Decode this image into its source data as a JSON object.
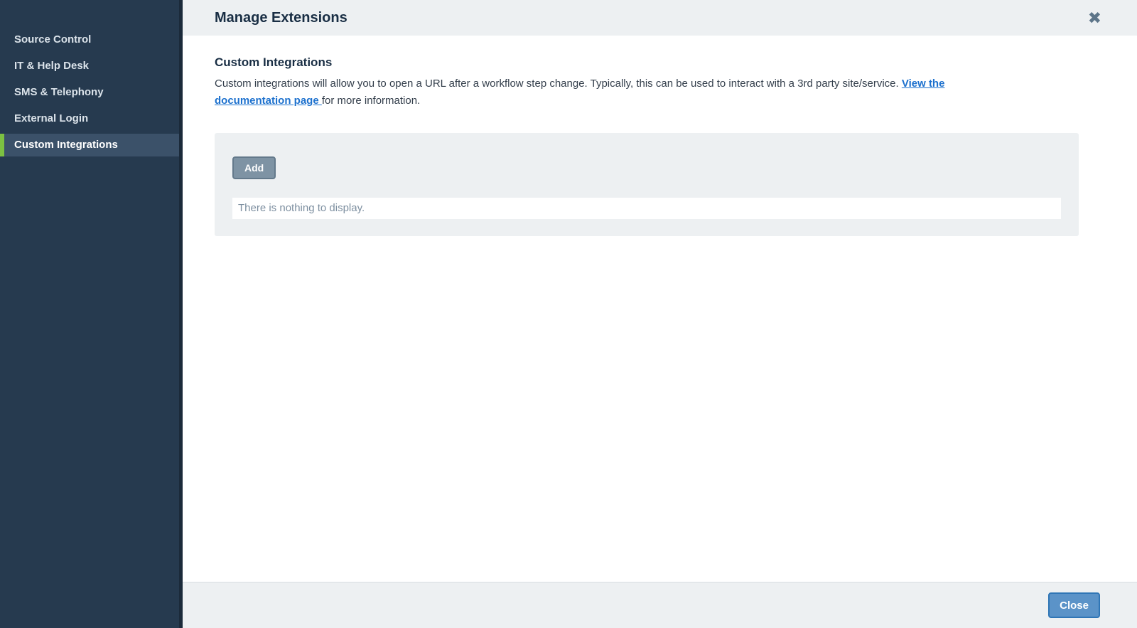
{
  "sidebar": {
    "items": [
      {
        "label": "Source Control",
        "selected": false
      },
      {
        "label": "IT & Help Desk",
        "selected": false
      },
      {
        "label": "SMS & Telephony",
        "selected": false
      },
      {
        "label": "External Login",
        "selected": false
      },
      {
        "label": "Custom Integrations",
        "selected": true
      }
    ]
  },
  "header": {
    "title": "Manage Extensions",
    "close_icon": "✖"
  },
  "main": {
    "section_title": "Custom Integrations",
    "description_before_link": "Custom integrations will allow you to open a URL after a workflow step change. Typically, this can be used to interact with a 3rd party site/service. ",
    "link_text": "View the documentation page ",
    "description_after_link": "for more information.",
    "add_button_label": "Add",
    "empty_message": "There is nothing to display."
  },
  "footer": {
    "close_button_label": "Close"
  },
  "colors": {
    "sidebar_bg": "#263a4f",
    "sidebar_border": "#1b2a3a",
    "sidebar_selected_bg": "#3b5169",
    "sidebar_text": "#dbe3ea",
    "accent_green": "#7cc142",
    "chrome_bg": "#edf0f2",
    "heading_color": "#192e44",
    "body_text": "#333e4b",
    "link_color": "#1d71ce",
    "muted_text": "#7d8fa0",
    "icon_slate": "#5d7589",
    "add_btn_bg": "#7e93a4",
    "add_btn_border": "#63798b",
    "close_btn_bg": "#5b93c8",
    "close_btn_border": "#3076b6",
    "footer_border": "#d9dee2"
  }
}
